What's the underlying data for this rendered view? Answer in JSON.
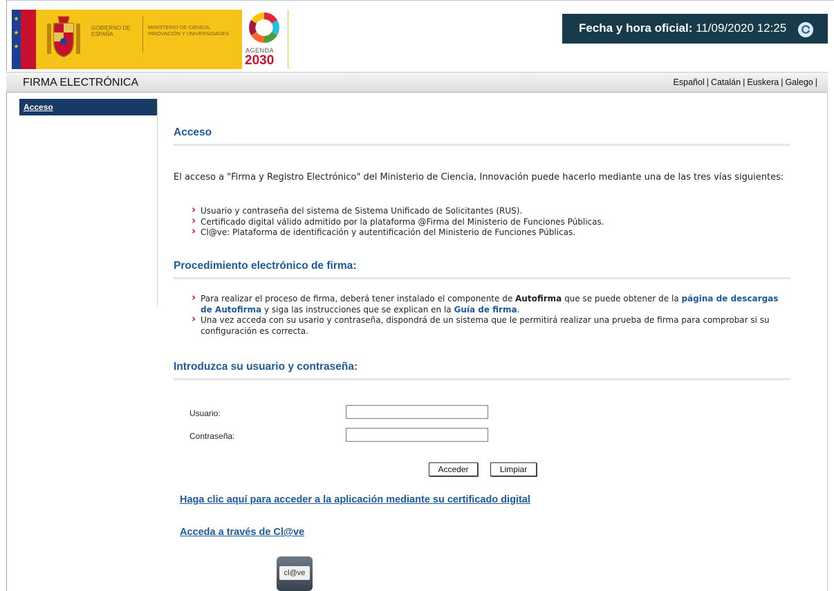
{
  "header": {
    "gobierno": "GOBIERNO DE ESPAÑA",
    "ministerio": "MINISTERIO DE CIENCIA, INNOVACIÓN Y UNIVERSIDADES",
    "agenda_label": "AGENDA",
    "agenda_year": "2030",
    "clock_label": "Fecha y hora oficial:",
    "clock_value": "11/09/2020 12:25",
    "brand_yellow": "#f6c418",
    "brand_red": "#c8102e",
    "clock_bg": "#173b4b"
  },
  "title_bar": {
    "title": "FIRMA ELECTRÓNICA",
    "languages": [
      "Español",
      "Catalán",
      "Euskera",
      "Galego"
    ]
  },
  "sidebar": {
    "items": [
      {
        "label": "Acceso",
        "active": true
      }
    ]
  },
  "main": {
    "acceso": {
      "title": "Acceso",
      "intro": "El acceso a \"Firma y Registro Electrónico\" del Ministerio de Ciencia, Innovación puede hacerlo mediante una de las tres vías siguientes:",
      "bullets": [
        "Usuario y contraseña del sistema de Sistema Unificado de Solicitantes (RUS).",
        "Certificado digital válido admitido por la plataforma @Firma del Ministerio de Funciones Públicas.",
        "Cl@ve: Plataforma de identificación y autentificación del Ministerio de Funciones Públicas."
      ]
    },
    "procedimiento": {
      "title": "Procedimiento electrónico de firma:",
      "b1_part1": "Para realizar el proceso de firma, deberá tener instalado el componente de ",
      "b1_bold": "Autofirma",
      "b1_part2": " que se puede obtener de la ",
      "b1_link": "página de descargas de Autofirma",
      "b1_part3": " y siga las instrucciones que se explican en la ",
      "b1_link2": "Guía de firma",
      "b1_end": ".",
      "b2": "Una vez acceda con su usario y contraseña, dispondrá de un sistema que le permitirá realizar una prueba de firma para comprobar si su configuración es correcta."
    },
    "login": {
      "title": "Introduzca su usuario y contraseña:",
      "usuario_label": "Usuario:",
      "usuario_value": "",
      "password_label": "Contraseña:",
      "password_value": "",
      "acceder": "Acceder",
      "limpiar": "Limpiar"
    },
    "cert_link": "Haga clic aquí para acceder a la aplicación mediante su certificado digital",
    "clave_link": "Acceda a través de Cl@ve",
    "clave_logo_text": "cl@ve"
  }
}
